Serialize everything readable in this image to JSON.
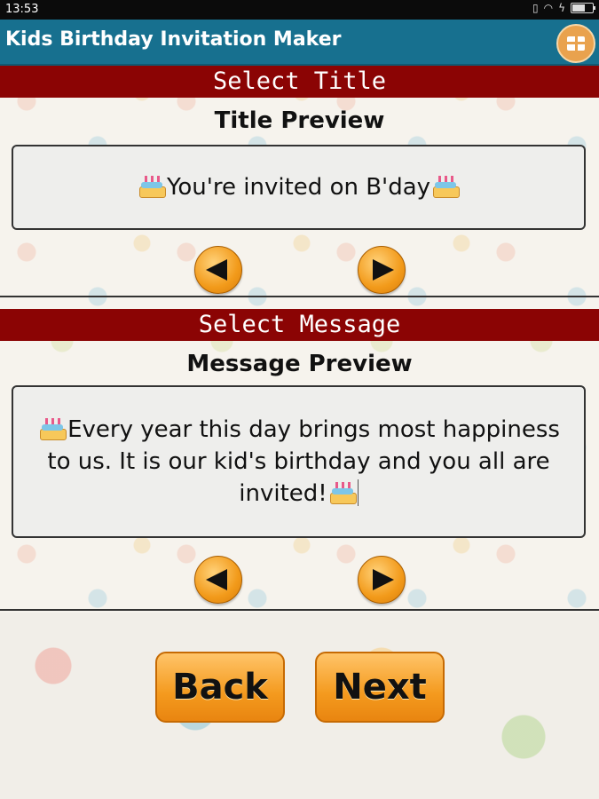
{
  "status_bar": {
    "time": "13:53"
  },
  "app_bar": {
    "title": "Kids Birthday Invitation Maker",
    "gift_icon": "gift-icon"
  },
  "title_section": {
    "header": "Select Title",
    "preview_label": "Title Preview",
    "preview_text": "You're invited on B'day",
    "prev_icon": "arrow-left-icon",
    "next_icon": "arrow-right-icon"
  },
  "message_section": {
    "header": "Select Message",
    "preview_label": "Message Preview",
    "preview_text": "Every year this day brings most happiness to us. It is our kid's birthday and you all are invited!",
    "prev_icon": "arrow-left-icon",
    "next_icon": "arrow-right-icon"
  },
  "buttons": {
    "back_label": "Back",
    "next_label": "Next"
  },
  "colors": {
    "app_bar": "#17708f",
    "section_header": "#8b0404",
    "button_orange": "#f49a1e"
  }
}
